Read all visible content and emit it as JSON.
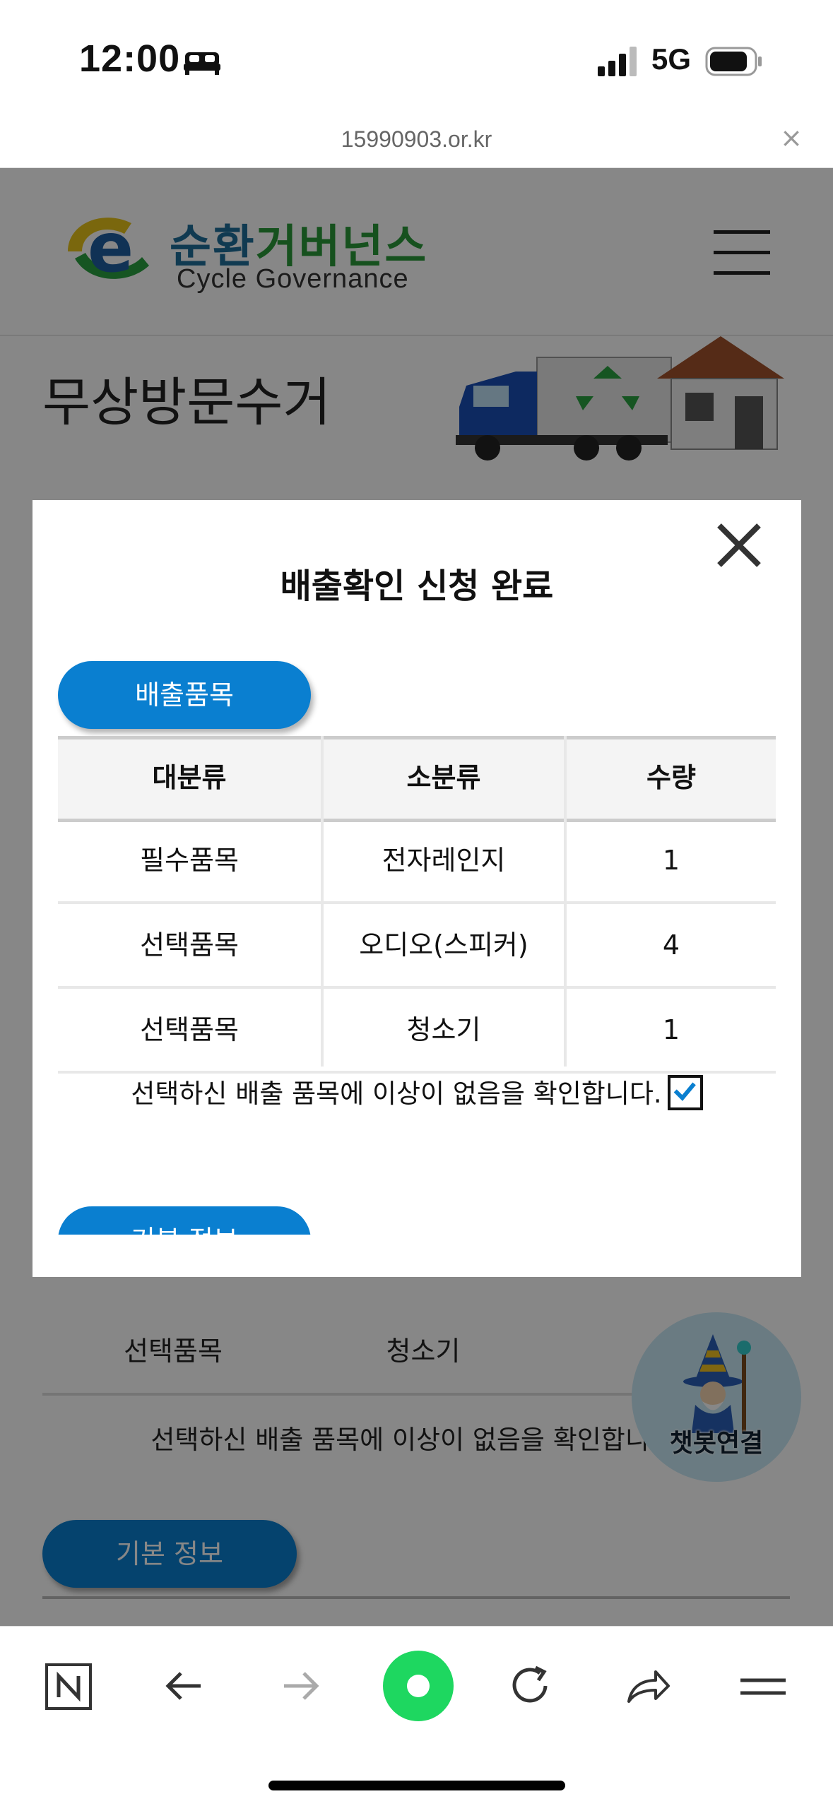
{
  "status_bar": {
    "time": "12:00",
    "network": "5G"
  },
  "browser": {
    "url": "15990903.or.kr"
  },
  "site": {
    "logo_ko_part1": "순환",
    "logo_ko_part2": "거버넌스",
    "logo_en": "Cycle Governance",
    "page_title": "무상방문수거"
  },
  "background_content": {
    "row": [
      "선택품목",
      "청소기"
    ],
    "note": "선택하신 배출 품목에 이상이 없음을 확인합니다.",
    "basic_info_button": "기본 정보"
  },
  "chatbot": {
    "label": "챗봇연결"
  },
  "modal": {
    "title": "배출확인 신청 완료",
    "section_button": "배출품목",
    "table": {
      "headers": [
        "대분류",
        "소분류",
        "수량"
      ],
      "rows": [
        [
          "필수품목",
          "전자레인지",
          "1"
        ],
        [
          "선택품목",
          "오디오(스피커)",
          "4"
        ],
        [
          "선택품목",
          "청소기",
          "1"
        ]
      ]
    },
    "confirm_text": "선택하신 배출 품목에 이상이 없음을 확인합니다.",
    "confirm_checked": true,
    "next_section_button": "기본 정보"
  },
  "colors": {
    "accent": "#0a7fd0",
    "chat_green": "#1ed760"
  }
}
